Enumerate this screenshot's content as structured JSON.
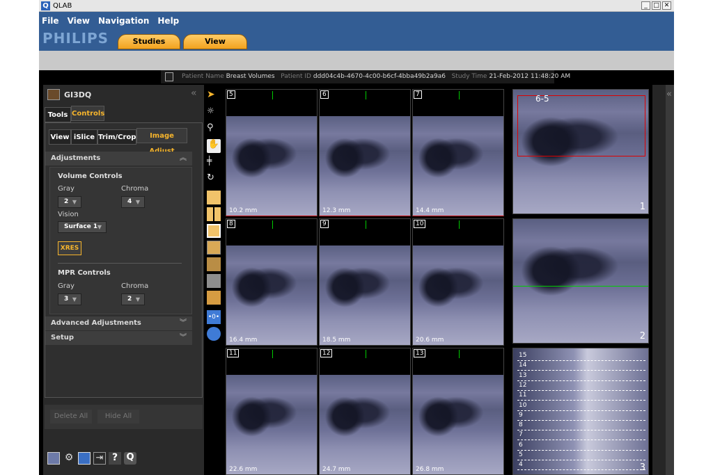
{
  "window": {
    "title": "QLAB",
    "app_letter": "Q",
    "controls": {
      "min": "_",
      "max": "□",
      "close": "✕"
    }
  },
  "menu": [
    "File",
    "View",
    "Navigation",
    "Help"
  ],
  "logo": "PHILIPS",
  "main_tabs": {
    "studies": "Studies",
    "view": "View"
  },
  "patient": {
    "name_label": "Patient Name",
    "name_value": "Breast Volumes",
    "id_label": "Patient ID",
    "id_value": "ddd04c4b-4670-4c00-b6cf-4bba49b2a9a6",
    "time_label": "Study Time",
    "time_value": "21-Feb-2012 11:48:20 AM"
  },
  "panel": {
    "title": "GI3DQ",
    "collapse": "«",
    "top_tabs": [
      "Tools",
      "Controls"
    ],
    "sub_tabs": [
      "View",
      "iSlice",
      "Trim/Crop",
      "Image Adjust"
    ],
    "adjustments": "Adjustments",
    "volume_controls": "Volume Controls",
    "gray_label": "Gray",
    "chroma_label": "Chroma",
    "vol_gray": "2",
    "vol_chroma": "4",
    "vision_label": "Vision",
    "vision_value": "Surface 1",
    "xres": "XRES",
    "mpr_controls": "MPR Controls",
    "mpr_gray": "3",
    "mpr_chroma": "2",
    "advanced": "Advanced Adjustments",
    "setup": "Setup",
    "delete_all": "Delete All",
    "hide_all": "Hide All",
    "help_icon": "?",
    "q_icon": "Q"
  },
  "slices": [
    {
      "n": "5",
      "mm": "10.2 mm"
    },
    {
      "n": "6",
      "mm": "12.3 mm"
    },
    {
      "n": "7",
      "mm": "14.4 mm"
    },
    {
      "n": "8",
      "mm": "16.4 mm"
    },
    {
      "n": "9",
      "mm": "18.5 mm"
    },
    {
      "n": "10",
      "mm": "20.6 mm"
    },
    {
      "n": "11",
      "mm": "22.6 mm"
    },
    {
      "n": "12",
      "mm": "24.7 mm"
    },
    {
      "n": "13",
      "mm": "26.8 mm"
    }
  ],
  "right_views": {
    "label_65": "6-5",
    "v1": "1",
    "v2": "2",
    "v3": "3"
  },
  "slice_lines": [
    "15",
    "14",
    "13",
    "12",
    "11",
    "10",
    "9",
    "8",
    "7",
    "6",
    "5",
    "4"
  ],
  "right_collapse": "«"
}
